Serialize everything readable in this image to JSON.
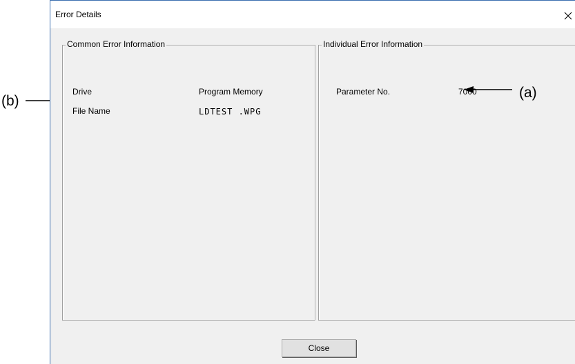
{
  "window": {
    "title": "Error Details",
    "close_glyph": "×"
  },
  "common": {
    "legend": "Common Error Information",
    "rows": [
      {
        "label": "Drive",
        "value": "Program Memory"
      },
      {
        "label": "File Name",
        "value": "LDTEST .WPG"
      }
    ]
  },
  "individual": {
    "legend": "Individual Error Information",
    "rows": [
      {
        "label": "Parameter No.",
        "value": "7000"
      }
    ]
  },
  "buttons": {
    "close_label": "Close"
  },
  "annotations": {
    "a_label": "(a)",
    "b_label": "(b)"
  },
  "icons": [
    "close-icon",
    "arrow-left-icon",
    "arrow-right-icon"
  ],
  "colors": {
    "window_border": "#3c6fb0",
    "dialog_background": "#f0f0f0",
    "titlebar_background": "#ffffff",
    "group_border": "#a0a0a0"
  }
}
